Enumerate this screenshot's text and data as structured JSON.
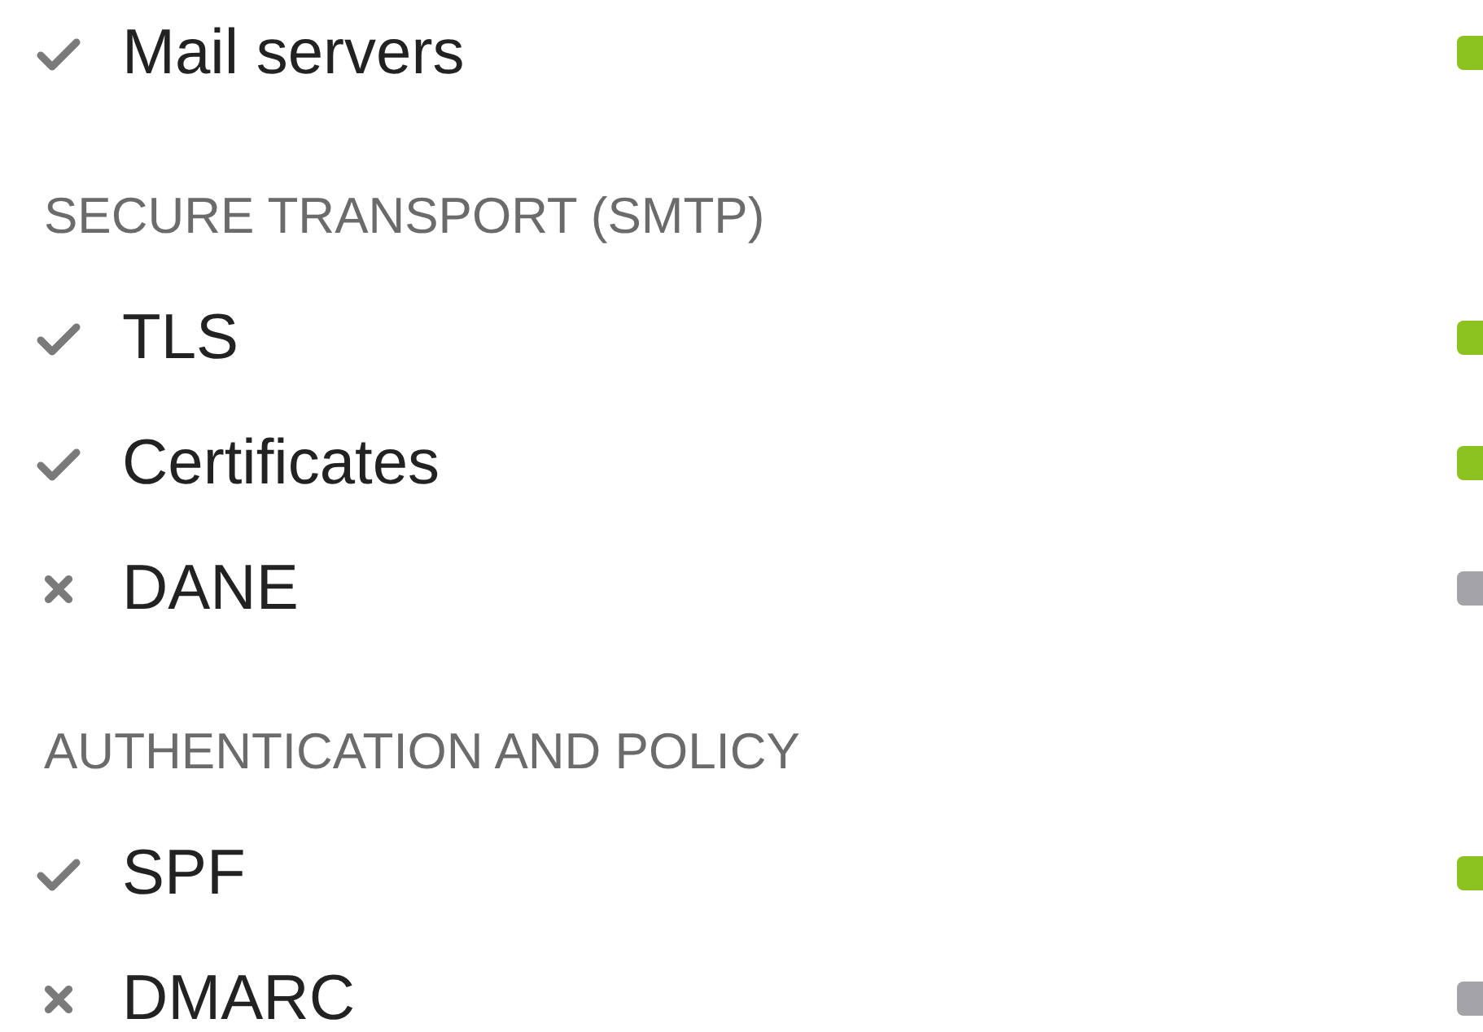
{
  "sections": [
    {
      "items": [
        {
          "label": "Mail servers",
          "passed": true
        }
      ]
    },
    {
      "title": "SECURE TRANSPORT (SMTP)",
      "items": [
        {
          "label": "TLS",
          "passed": true
        },
        {
          "label": "Certificates",
          "passed": true
        },
        {
          "label": "DANE",
          "passed": false
        }
      ]
    },
    {
      "title": "AUTHENTICATION AND POLICY",
      "items": [
        {
          "label": "SPF",
          "passed": true
        },
        {
          "label": "DMARC",
          "passed": false
        }
      ]
    }
  ]
}
